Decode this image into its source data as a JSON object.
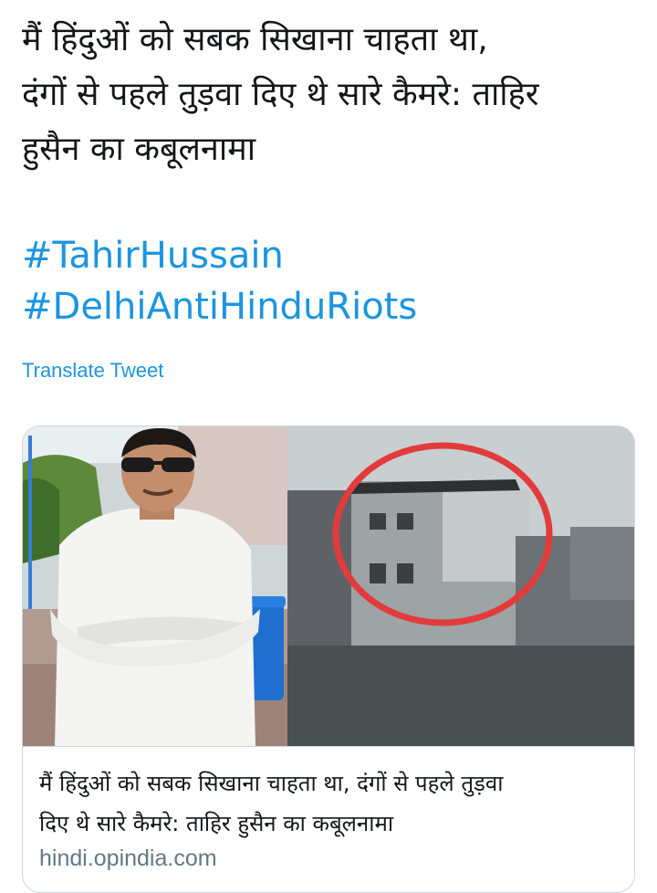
{
  "tweet": {
    "text_lines": [
      "मैं हिंदुओं को सबक सिखाना चाहता था,",
      "दंगों से पहले तुड़वा दिए थे सारे कैमरे: ताहिर",
      "हुसैन का कबूलनामा"
    ],
    "hashtags": [
      "#TahirHussain",
      "#DelhiAntiHinduRiots"
    ],
    "translate_label": "Translate Tweet"
  },
  "card": {
    "title_lines": [
      "मैं हिंदुओं को सबक सिखाना चाहता था, दंगों से पहले तुड़वा",
      "दिए थे सारे कैमरे: ताहिर हुसैन का कबूलनामा"
    ],
    "domain": "hindi.opindia.com"
  },
  "colors": {
    "link": "#1b95e0",
    "text": "#14171a",
    "muted": "#657786",
    "border": "#ccd6dd",
    "highlight_circle": "#e23b3b"
  }
}
